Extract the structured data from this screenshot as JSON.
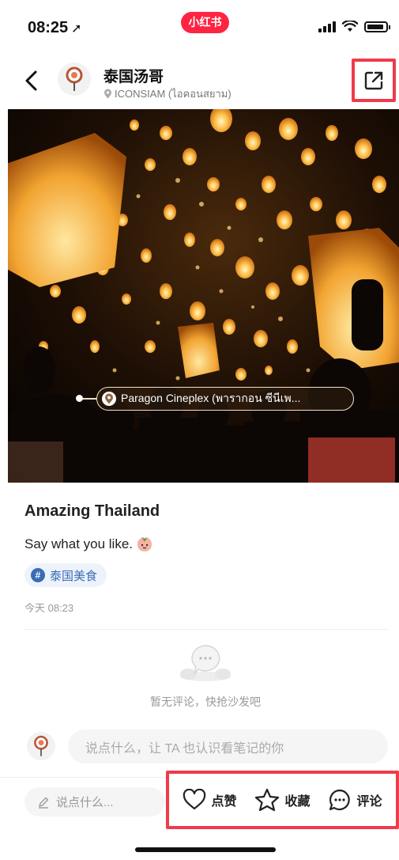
{
  "status_bar": {
    "time": "08:25",
    "time_arrow": "➚",
    "brand": "小红书"
  },
  "header": {
    "back_icon": "chevron-left-icon",
    "name": "泰国汤哥",
    "location": "ICONSIAM (ไอคอนสยาม)",
    "share_icon": "share-external-icon"
  },
  "photo": {
    "description_icon": "photo",
    "location_tag": "Paragon Cineplex (พารากอน ซีนีเพ..."
  },
  "post": {
    "title": "Amazing Thailand",
    "text": "Say what you like.",
    "hashtag": "泰国美食",
    "time": "今天 08:23"
  },
  "comments": {
    "empty_text": "暂无评论，快抢沙发吧",
    "input_placeholder": "说点什么，让 TA 也认识看笔记的你"
  },
  "bottom_bar": {
    "say_placeholder": "说点什么...",
    "like_label": "点赞",
    "collect_label": "收藏",
    "comment_label": "评论"
  },
  "colors": {
    "brand": "#ff2442",
    "highlight_box": "#ef3b4a",
    "hashtag": "#3a6bb5"
  }
}
